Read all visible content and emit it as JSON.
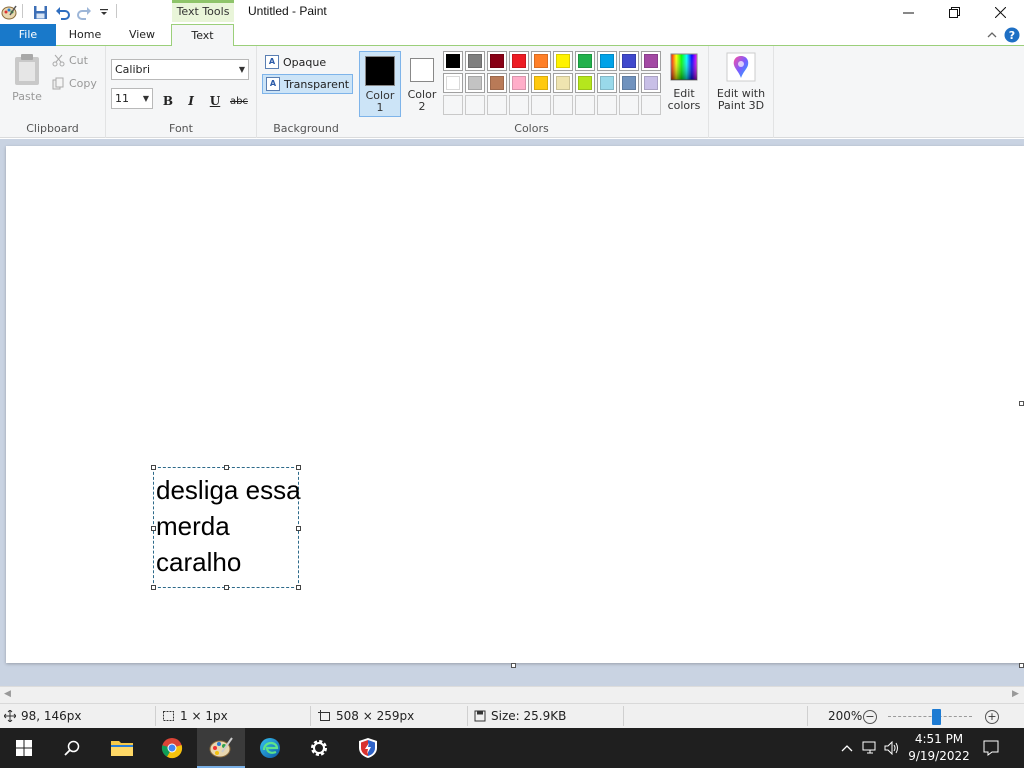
{
  "window": {
    "title": "Untitled - Paint",
    "context_tab": "Text Tools"
  },
  "tabs": [
    {
      "label": "File"
    },
    {
      "label": "Home"
    },
    {
      "label": "View"
    },
    {
      "label": "Text"
    }
  ],
  "clipboard": {
    "paste": "Paste",
    "cut": "Cut",
    "copy": "Copy",
    "label": "Clipboard"
  },
  "font": {
    "family": "Calibri",
    "size": "11",
    "bold": "B",
    "italic": "I",
    "underline": "U",
    "strikethrough": "abc",
    "label": "Font"
  },
  "background": {
    "opaque": "Opaque",
    "transparent": "Transparent",
    "label": "Background",
    "selected": "Transparent"
  },
  "colors": {
    "color1_label": "Color\n1",
    "color2_label": "Color\n2",
    "color1": "#000000",
    "color2": "#ffffff",
    "edit_colors": "Edit\ncolors",
    "label": "Colors",
    "palette_row1": [
      "#000000",
      "#7f7f7f",
      "#880015",
      "#ed1c24",
      "#ff7f27",
      "#fff200",
      "#22b14c",
      "#00a2e8",
      "#3f48cc",
      "#a349a4"
    ],
    "palette_row2": [
      "#ffffff",
      "#c3c3c3",
      "#b97a57",
      "#ffaec9",
      "#ffc90e",
      "#efe4b0",
      "#b5e61d",
      "#99d9ea",
      "#7092be",
      "#c8bfe7"
    ]
  },
  "paint3d": {
    "label": "Edit with\nPaint 3D"
  },
  "canvas": {
    "text_lines": [
      "desliga essa",
      "merda",
      "caralho"
    ]
  },
  "status": {
    "cursor_pos": "98, 146px",
    "selection_size": "1 × 1px",
    "image_size": "508 × 259px",
    "file_size": "Size: 25.9KB",
    "zoom": "200%"
  },
  "taskbar": {
    "time": "4:51 PM",
    "date": "9/19/2022"
  }
}
